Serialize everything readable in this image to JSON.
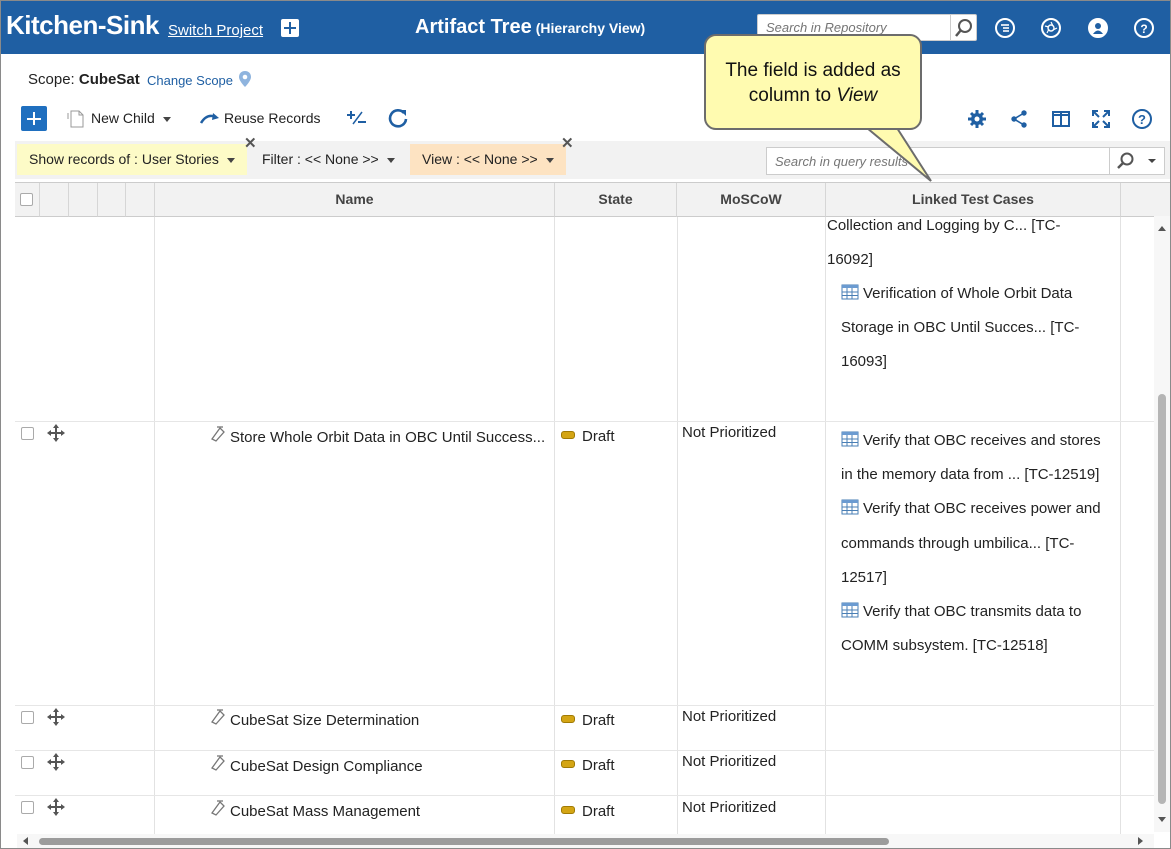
{
  "header": {
    "app_name": "Kitchen-Sink",
    "switch_project": "Switch Project",
    "title": "Artifact Tree",
    "subtitle": "(Hierarchy View)",
    "search_placeholder": "Search in Repository"
  },
  "scope": {
    "label": "Scope:",
    "value": "CubeSat",
    "change_scope": "Change Scope"
  },
  "toolbar": {
    "new_child": "New Child",
    "reuse_records": "Reuse Records"
  },
  "filters": {
    "show_records": "Show records of : User Stories",
    "filter": "Filter : << None >>",
    "view": "View : << None >>",
    "query_placeholder": "Search in query results"
  },
  "callout": {
    "text_before": "The field is added as column to",
    "emphasis": "View"
  },
  "columns": {
    "name": "Name",
    "state": "State",
    "moscow": "MoSCoW",
    "linked_test_cases": "Linked Test Cases"
  },
  "rows": [
    {
      "name": "",
      "state": "",
      "moscow": "",
      "test_cases": [
        {
          "line1": "Collection and Logging by C... [TC-",
          "line2": "16092]",
          "icon": false
        },
        {
          "line1": "Verification of Whole Orbit Data",
          "line2": "Storage in OBC Until Succes... [TC-",
          "line3": "16093]",
          "icon": true
        }
      ]
    },
    {
      "name": "Store Whole Orbit Data in OBC Until Success...",
      "state": "Draft",
      "moscow": "Not Prioritized",
      "test_cases": [
        {
          "line1": "Verify that OBC receives and stores",
          "line2": "in the memory data from ... [TC-12519]",
          "icon": true
        },
        {
          "line1": "Verify that OBC receives power and",
          "line2": "commands through umbilica... [TC-",
          "line3": "12517]",
          "icon": true
        },
        {
          "line1": "Verify that OBC transmits data to",
          "line2": "COMM subsystem. [TC-12518]",
          "icon": true
        }
      ]
    },
    {
      "name": "CubeSat Size Determination",
      "state": "Draft",
      "moscow": "Not Prioritized"
    },
    {
      "name": "CubeSat Design Compliance",
      "state": "Draft",
      "moscow": "Not Prioritized"
    },
    {
      "name": "CubeSat Mass Management",
      "state": "Draft",
      "moscow": "Not Prioritized"
    }
  ],
  "colors": {
    "header_bg": "#1f5fa3",
    "callout_bg": "#fffbb0",
    "show_chip_bg": "#fdfbc7",
    "view_chip_bg": "#fde3c2",
    "draft_badge": "#d4a514"
  }
}
